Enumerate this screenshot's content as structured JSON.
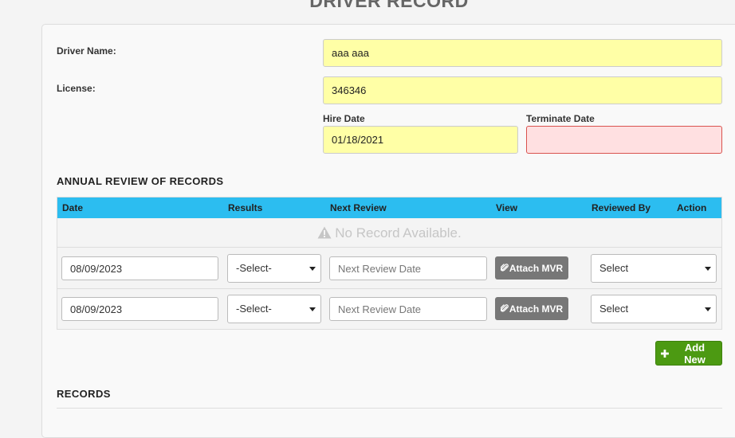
{
  "page_title": "DRIVER RECORD",
  "form": {
    "driver_name_label": "Driver Name:",
    "driver_name_value": "aaa aaa",
    "license_label": "License:",
    "license_value": "346346",
    "hire_date_label": "Hire Date",
    "hire_date_value": "01/18/2021",
    "terminate_date_label": "Terminate Date",
    "terminate_date_value": ""
  },
  "annual_review": {
    "title": "ANNUAL REVIEW OF RECORDS",
    "columns": [
      "Date",
      "Results",
      "Next Review",
      "View",
      "Reviewed By",
      "Action"
    ],
    "no_record_text": "No Record Available.",
    "rows": [
      {
        "date": "08/09/2023",
        "results": "-Select-",
        "next_review_placeholder": "Next Review Date",
        "attach_label": "Attach MVR",
        "reviewed_by": "Select"
      },
      {
        "date": "08/09/2023",
        "results": "-Select-",
        "next_review_placeholder": "Next Review Date",
        "attach_label": "Attach MVR",
        "reviewed_by": "Select"
      }
    ],
    "add_new_label": "Add New"
  },
  "records_section": {
    "title": "RECORDS"
  },
  "colors": {
    "table_header": "#2cbdf0",
    "required_field": "#ffffa6",
    "invalid_field": "#ffe0e1",
    "add_button": "#4c9a12",
    "attach_button": "#777777"
  },
  "icons": {
    "no_record": "warning-triangle-icon",
    "attach": "paperclip-icon",
    "add": "plus-icon",
    "select": "caret-down-icon"
  }
}
